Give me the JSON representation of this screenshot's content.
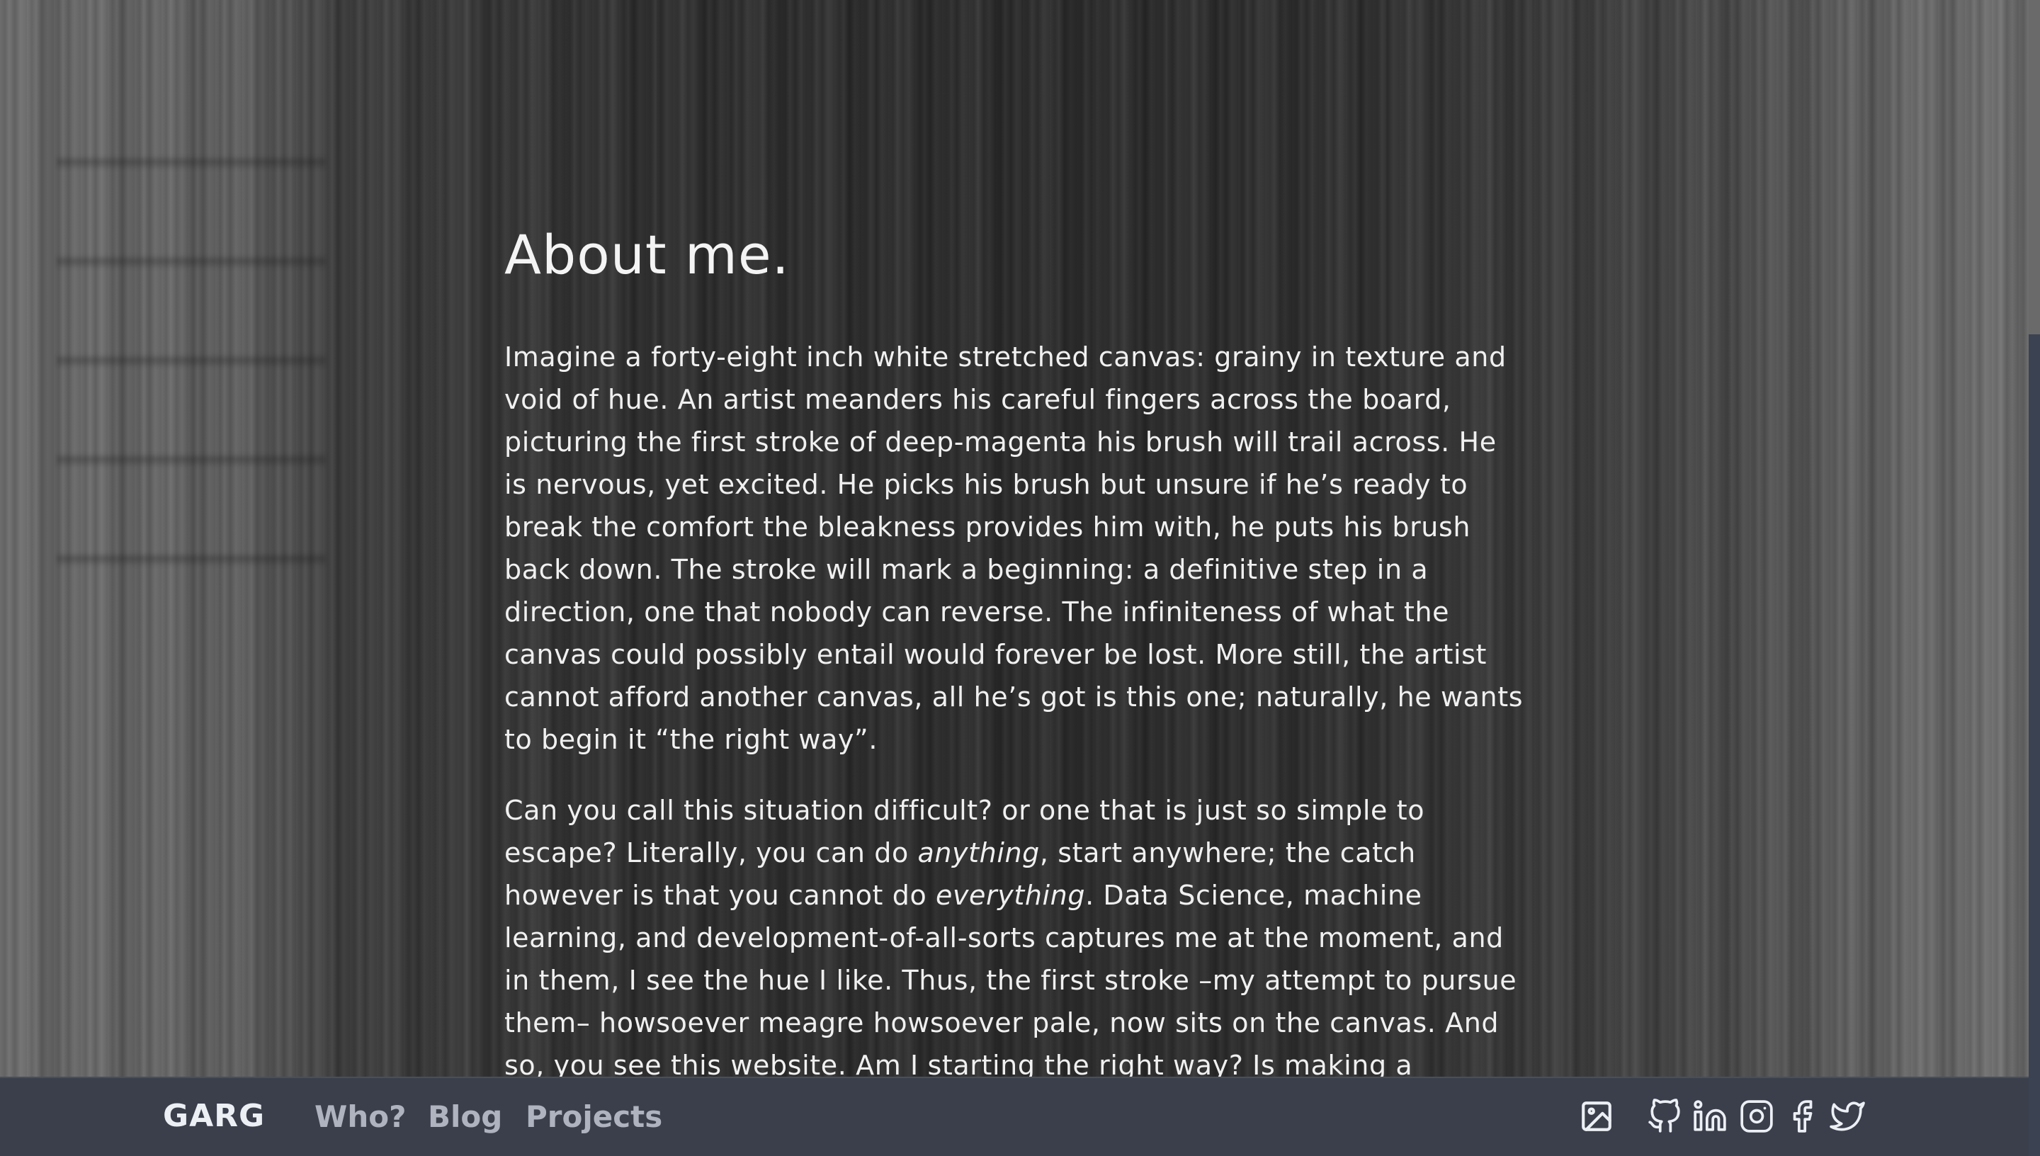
{
  "page": {
    "title": "About me.",
    "paragraphs": [
      {
        "text": "Imagine a forty-eight inch white stretched canvas: grainy in texture and void of hue. An artist meanders his careful fingers across the board, picturing the first stroke of deep-magenta his brush will trail across. He is nervous, yet excited. He picks his brush but unsure if he’s ready to break the comfort the bleakness provides him with, he puts his brush back down. The stroke will mark a beginning: a definitive step in a direction, one that nobody can reverse. The infiniteness of what the canvas could possibly entail would forever be lost. More still, the artist cannot afford another canvas, all he’s got is this one; naturally, he wants to begin it “the right way”."
      },
      {
        "part1": "Can you call this situation difficult? or one that is just so simple to escape? Literally, you can do ",
        "em1": "anything",
        "part2": ", start anywhere; the catch however is that you cannot do ",
        "em2": "everything",
        "part3": ". Data Science, machine learning, and development-of-all-sorts captures me at the moment, and in them, I see the hue I like. Thus, the first stroke –my attempt to pursue them– howsoever meagre howsoever pale, now sits on the canvas. And so, you see this website. Am I starting the right way? Is making a"
      }
    ]
  },
  "navbar": {
    "brand": "GARG",
    "links": [
      "Who?",
      "Blog",
      "Projects"
    ],
    "icons": [
      "image-icon",
      "github-icon",
      "linkedin-icon",
      "instagram-icon",
      "facebook-icon",
      "twitter-icon"
    ]
  },
  "colors": {
    "navbar_bg": "#3b3f4c",
    "nav_link": "#aeb3bf",
    "brand": "#eceff4",
    "text": "#f0f0f0"
  }
}
